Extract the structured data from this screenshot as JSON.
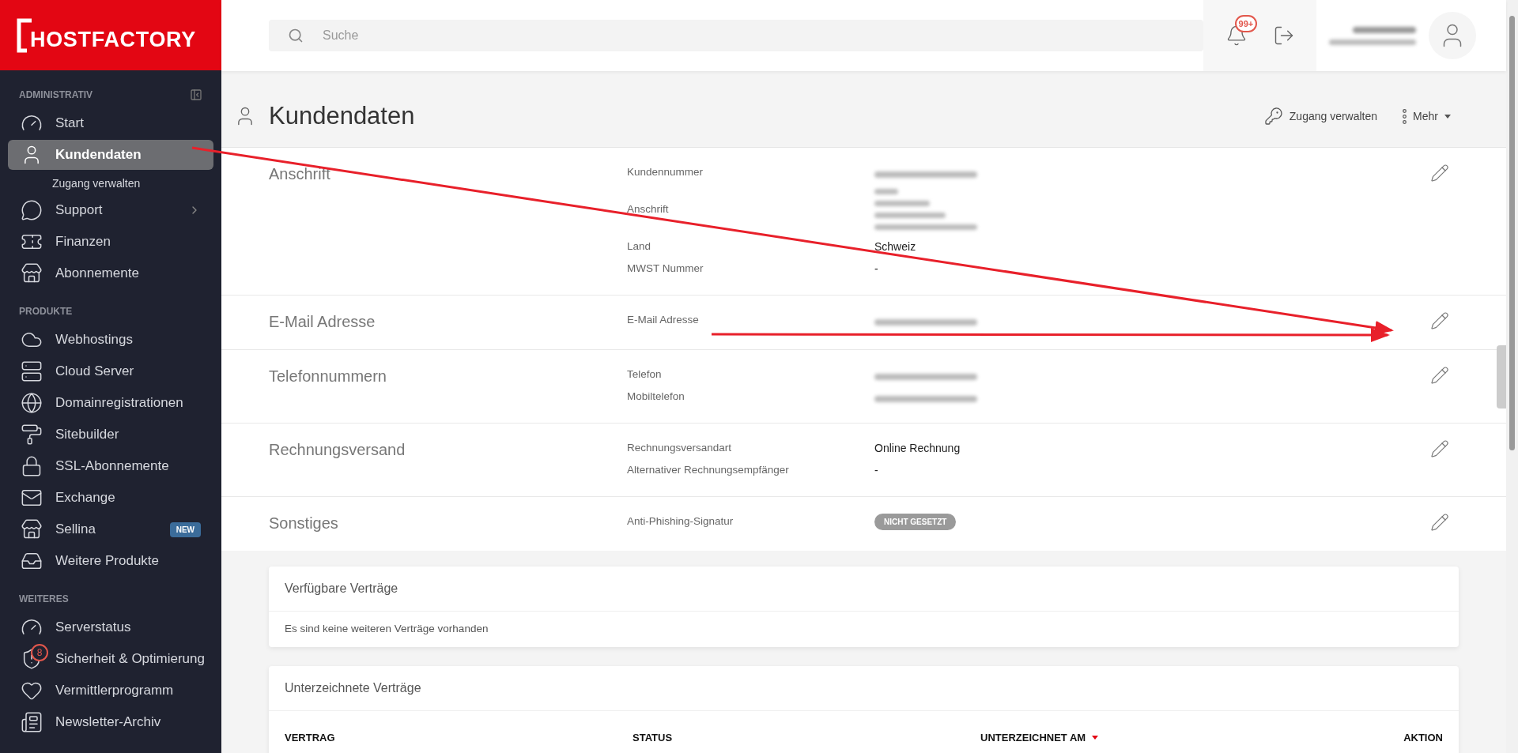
{
  "brand": {
    "logo_text": "HOSTFACTORY"
  },
  "search": {
    "placeholder": "Suche"
  },
  "header": {
    "notifications_badge": "99+"
  },
  "sidebar": {
    "groups": [
      {
        "heading": "ADMINISTRATIV",
        "items": [
          {
            "label": "Start",
            "selected": false
          },
          {
            "label": "Kundendaten",
            "selected": true,
            "children": [
              {
                "label": "Zugang verwalten"
              }
            ]
          },
          {
            "label": "Support",
            "selected": false,
            "submenu": true
          },
          {
            "label": "Finanzen",
            "selected": false
          },
          {
            "label": "Abonnemente",
            "selected": false
          }
        ]
      },
      {
        "heading": "PRODUKTE",
        "items": [
          {
            "label": "Webhostings",
            "selected": false
          },
          {
            "label": "Cloud Server",
            "selected": false
          },
          {
            "label": "Domainregistrationen",
            "selected": false
          },
          {
            "label": "Sitebuilder",
            "selected": false
          },
          {
            "label": "SSL-Abonnemente",
            "selected": false
          },
          {
            "label": "Exchange",
            "selected": false
          },
          {
            "label": "Sellina",
            "selected": false,
            "tag": "NEW"
          },
          {
            "label": "Weitere Produkte",
            "selected": false
          }
        ]
      },
      {
        "heading": "WEITERES",
        "items": [
          {
            "label": "Serverstatus",
            "selected": false
          },
          {
            "label": "Sicherheit & Optimierung",
            "selected": false,
            "count": "8"
          },
          {
            "label": "Vermittlerprogramm",
            "selected": false
          },
          {
            "label": "Newsletter-Archiv",
            "selected": false
          }
        ]
      }
    ]
  },
  "page": {
    "title": "Kundendaten",
    "actions": [
      {
        "label": "Zugang verwalten",
        "dropdown": false
      },
      {
        "label": "Mehr",
        "dropdown": true
      }
    ]
  },
  "sections": [
    {
      "title": "Anschrift",
      "fields": [
        {
          "label": "Kundennummer",
          "kind": "redacted"
        },
        {
          "label": "Anschrift",
          "kind": "redacted_block"
        },
        {
          "label": "Land",
          "kind": "text",
          "value": "Schweiz"
        },
        {
          "label": "MWST Nummer",
          "kind": "text",
          "value": "-"
        }
      ]
    },
    {
      "title": "E-Mail Adresse",
      "fields": [
        {
          "label": "E-Mail Adresse",
          "kind": "redacted"
        }
      ]
    },
    {
      "title": "Telefonnummern",
      "fields": [
        {
          "label": "Telefon",
          "kind": "redacted"
        },
        {
          "label": "Mobiltelefon",
          "kind": "redacted"
        }
      ]
    },
    {
      "title": "Rechnungsversand",
      "fields": [
        {
          "label": "Rechnungsversandart",
          "kind": "text",
          "value": "Online Rechnung"
        },
        {
          "label": "Alternativer Rechnungsempfänger",
          "kind": "text",
          "value": "-"
        }
      ]
    },
    {
      "title": "Sonstiges",
      "fields": [
        {
          "label": "Anti-Phishing-Signatur",
          "kind": "tag",
          "value": "NICHT GESETZT"
        }
      ]
    }
  ],
  "cards": [
    {
      "title": "Verfügbare Verträge",
      "body": "Es sind keine weiteren Verträge vorhanden"
    },
    {
      "title": "Unterzeichnete Verträge",
      "columns": [
        {
          "label": "VERTRAG",
          "sorted": false
        },
        {
          "label": "STATUS",
          "sorted": false
        },
        {
          "label": "UNTERZEICHNET AM",
          "sorted": true
        },
        {
          "label": "AKTION",
          "sorted": false
        }
      ]
    }
  ],
  "annotations": [
    {
      "kind": "arrow"
    },
    {
      "kind": "arrow"
    }
  ]
}
